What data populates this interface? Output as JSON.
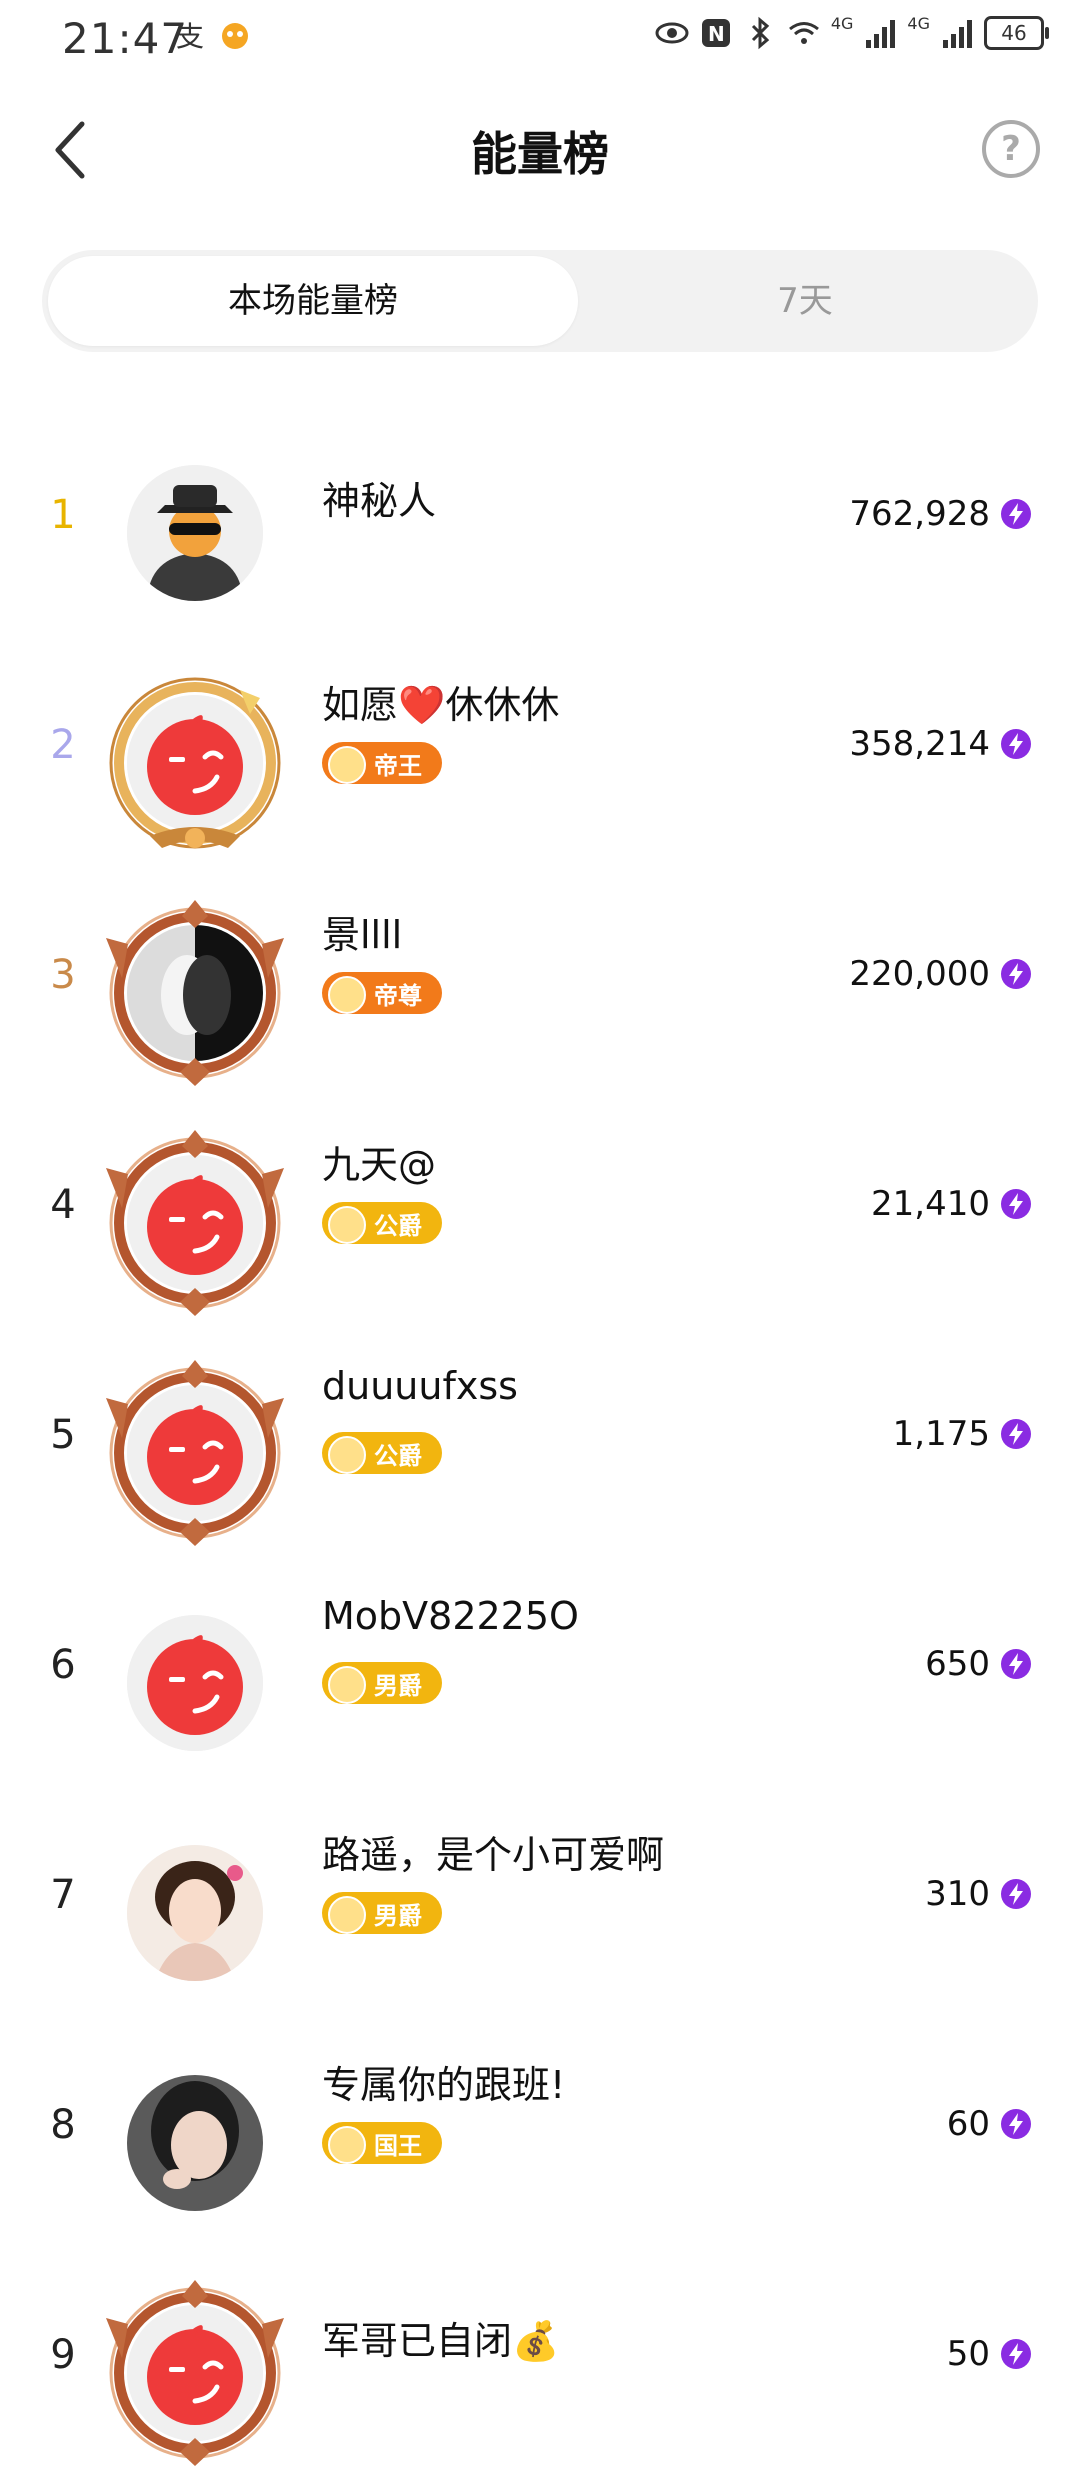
{
  "status_bar": {
    "time": "21:47",
    "left_icons": [
      "alipay-icon",
      "mascot-icon"
    ],
    "right_icons": [
      "eye-icon",
      "nfc-icon",
      "bluetooth-icon",
      "wifi-icon",
      "signal-icon",
      "signal-icon"
    ],
    "network_labels": [
      "4G",
      "4G"
    ],
    "battery": "46"
  },
  "header": {
    "title": "能量榜",
    "back_icon": "chevron-left-icon",
    "help_label": "?"
  },
  "tabs": [
    {
      "label": "本场能量榜",
      "active": true
    },
    {
      "label": "7天",
      "active": false
    }
  ],
  "colors": {
    "rank1": "#E8B400",
    "rank2": "#A9A7EB",
    "rank3": "#C98A4A",
    "energy": "#8A2BE2",
    "badge_orange": "#F27A1A",
    "badge_gold": "#F2B50F"
  },
  "rows": [
    {
      "rank": "1",
      "name": "神秘人",
      "score": "762,928",
      "badge": "",
      "avatar": "mystery-person-avatar"
    },
    {
      "rank": "2",
      "name": "如愿❤️休休休",
      "score": "358,214",
      "badge": "帝王",
      "avatar": "default-wink-avatar"
    },
    {
      "rank": "3",
      "name": "景llll",
      "score": "220,000",
      "badge": "帝尊",
      "avatar": "face-mask-avatar"
    },
    {
      "rank": "4",
      "name": "九天@",
      "score": "21,410",
      "badge": "公爵",
      "avatar": "default-wink-avatar"
    },
    {
      "rank": "5",
      "name": "duuuufxss",
      "score": "1,175",
      "badge": "公爵",
      "avatar": "default-wink-avatar"
    },
    {
      "rank": "6",
      "name": "MobV82225O",
      "score": "650",
      "badge": "男爵",
      "avatar": "default-wink-avatar"
    },
    {
      "rank": "7",
      "name": "路遥，是个小可爱啊",
      "score": "310",
      "badge": "男爵",
      "avatar": "girl-photo-avatar"
    },
    {
      "rank": "8",
      "name": "专属你的跟班!",
      "score": "60",
      "badge": "国王",
      "avatar": "woman-photo-avatar"
    },
    {
      "rank": "9",
      "name": "军哥已自闭💰",
      "score": "50",
      "badge": "",
      "avatar": "default-wink-avatar"
    }
  ]
}
